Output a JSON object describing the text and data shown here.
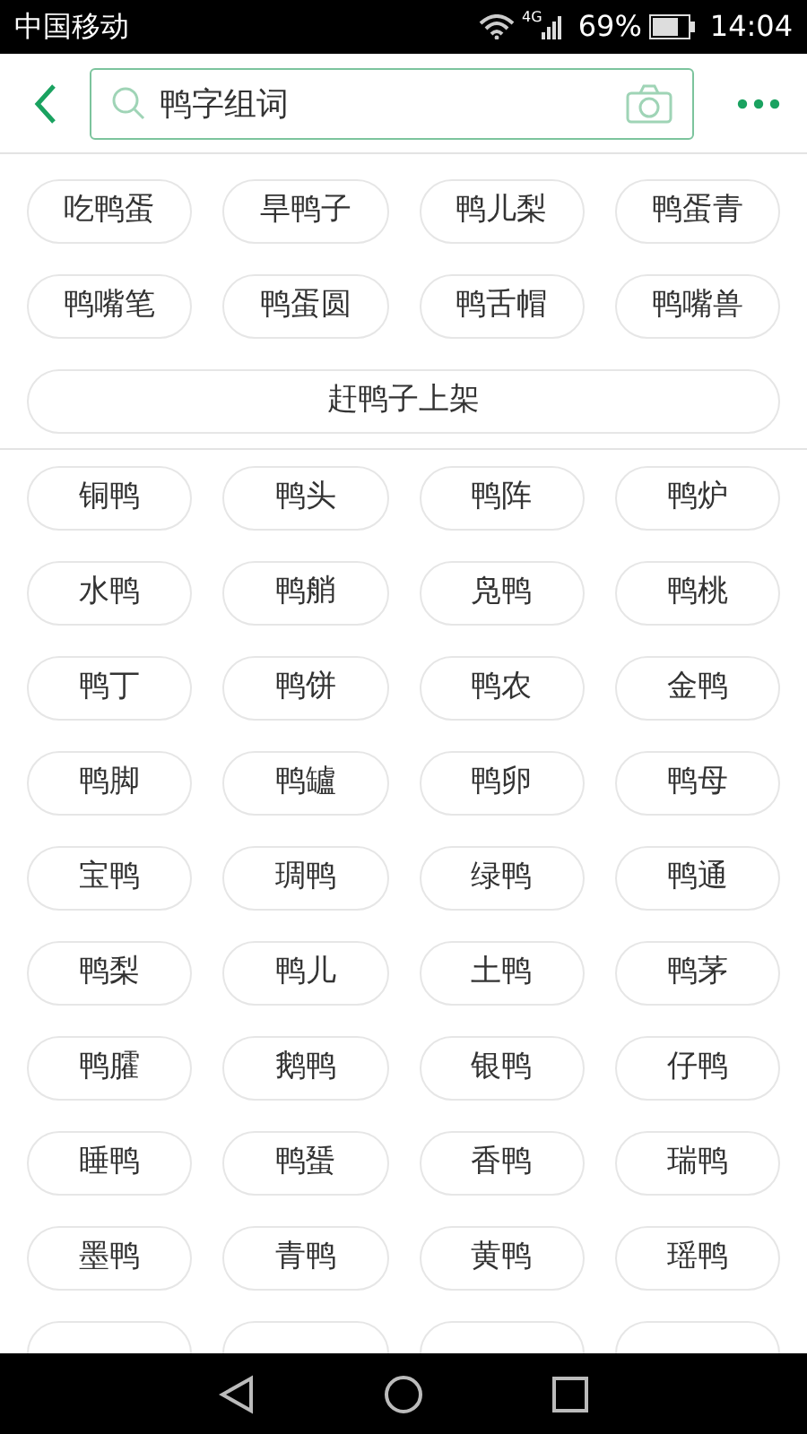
{
  "status_bar": {
    "carrier": "中国移动",
    "network": "4G",
    "battery": "69%",
    "time": "14:04"
  },
  "search": {
    "value": "鸭字组词"
  },
  "related_words": [
    "吃鸭蛋",
    "旱鸭子",
    "鸭儿梨",
    "鸭蛋青",
    "鸭嘴笔",
    "鸭蛋圆",
    "鸭舌帽",
    "鸭嘴兽"
  ],
  "related_phrase": "赶鸭子上架",
  "words": [
    "铜鸭",
    "鸭头",
    "鸭阵",
    "鸭炉",
    "水鸭",
    "鸭艄",
    "凫鸭",
    "鸭桃",
    "鸭丁",
    "鸭饼",
    "鸭农",
    "金鸭",
    "鸭脚",
    "鸭罏",
    "鸭卵",
    "鸭母",
    "宝鸭",
    "琱鸭",
    "绿鸭",
    "鸭通",
    "鸭梨",
    "鸭儿",
    "土鸭",
    "鸭茅",
    "鸭臛",
    "鹅鸭",
    "银鸭",
    "仔鸭",
    "睡鸭",
    "鸭蜑",
    "香鸭",
    "瑞鸭",
    "墨鸭",
    "青鸭",
    "黄鸭",
    "瑶鸭"
  ]
}
